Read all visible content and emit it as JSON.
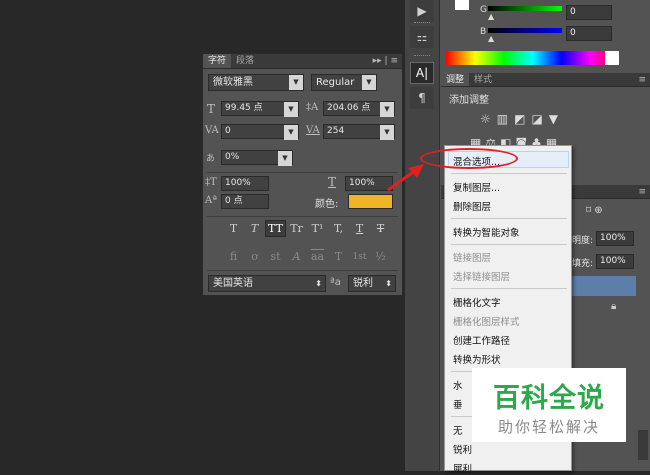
{
  "color_panel": {
    "g_label": "G",
    "g_value": "0",
    "b_label": "B",
    "b_value": "0"
  },
  "adjust_panel": {
    "tabs": [
      "调整",
      "样式"
    ],
    "title": "添加调整"
  },
  "layers_panel": {
    "opacity_label": "明度:",
    "opacity_value": "100%",
    "fill_label": "填充:",
    "fill_value": "100%"
  },
  "character_panel": {
    "tabs": [
      "字符",
      "段落"
    ],
    "font_family": "微软雅黑",
    "font_style": "Regular",
    "font_size": "99.45 点",
    "leading": "204.06 点",
    "kerning": "0",
    "tracking": "254",
    "tsume": "0%",
    "vertical_scale": "100%",
    "horizontal_scale": "100%",
    "baseline_shift": "0 点",
    "color_label": "颜色:",
    "color_swatch": "#f0b429",
    "style_buttons": [
      "T",
      "T",
      "TT",
      "Tr",
      "T¹",
      "T,",
      "T",
      "T"
    ],
    "opentype_buttons": [
      "fi",
      "ơ",
      "st",
      "A",
      "aa",
      "T",
      "1st",
      "½"
    ],
    "language": "美国英语",
    "aa_label": "ªa",
    "antialias": "锐利"
  },
  "context_menu": {
    "items": [
      {
        "label": "混合选项...",
        "enabled": true
      },
      {
        "label": "复制图层...",
        "enabled": true
      },
      {
        "label": "删除图层",
        "enabled": true
      },
      {
        "label": "转换为智能对象",
        "enabled": true
      },
      {
        "label": "链接图层",
        "enabled": false
      },
      {
        "label": "选择链接图层",
        "enabled": false
      },
      {
        "label": "栅格化文字",
        "enabled": true
      },
      {
        "label": "栅格化图层样式",
        "enabled": false
      },
      {
        "label": "创建工作路径",
        "enabled": true
      },
      {
        "label": "转换为形状",
        "enabled": true
      },
      {
        "label": "水",
        "enabled": true
      },
      {
        "label": "垂",
        "enabled": true
      },
      {
        "label": "无",
        "enabled": true
      },
      {
        "label": "锐利",
        "enabled": true
      },
      {
        "label": "犀利",
        "enabled": true
      }
    ]
  },
  "watermark": {
    "title": "百科全说",
    "subtitle": "助你轻松解决"
  },
  "colors": {
    "accent_red": "#e02020",
    "watermark_green": "#2ea84a"
  }
}
